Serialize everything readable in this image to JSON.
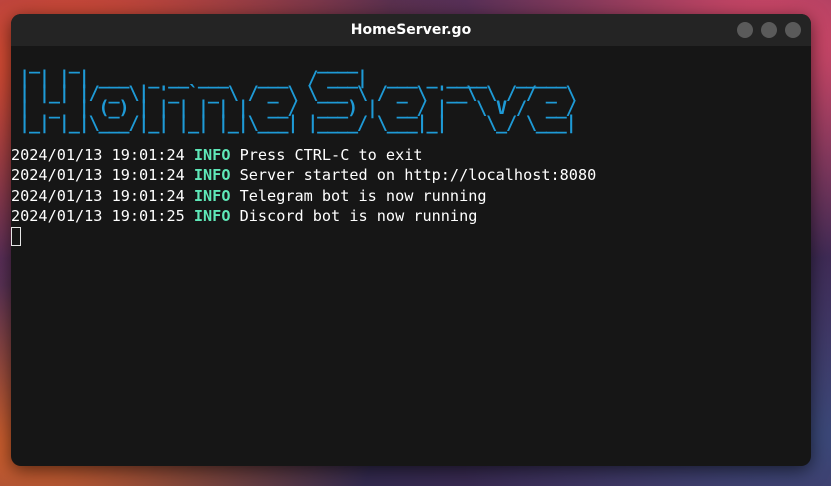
{
  "window": {
    "title": "HomeServer.go"
  },
  "terminal": {
    "banner": " _   _                        ____\n| | | | ___  _ __ ___   ___  / ___|  ___ _ ____   _____\n| |_| |/ _ \\| '_ ` _ \\ / _ \\ \\___ \\ / _ \\ '__\\ \\ / / _ \\\n|  _  | (_) | | | | | |  __/  ___) |  __/ |   \\ V /  __/\n|_| |_|\\___/|_| |_| |_|\\___| |____/ \\___|_|    \\_/ \\___|",
    "logs": [
      {
        "timestamp": "2024/01/13 19:01:24",
        "level": "INFO",
        "message": "Press CTRL-C to exit"
      },
      {
        "timestamp": "2024/01/13 19:01:24",
        "level": "INFO",
        "message": "Server started on http://localhost:8080"
      },
      {
        "timestamp": "2024/01/13 19:01:24",
        "level": "INFO",
        "message": "Telegram bot is now running"
      },
      {
        "timestamp": "2024/01/13 19:01:25",
        "level": "INFO",
        "message": "Discord bot is now running"
      }
    ]
  },
  "colors": {
    "banner": "#1e9ad6",
    "level_info": "#5fe8b8",
    "text": "#ffffff",
    "terminal_bg": "#161616"
  }
}
